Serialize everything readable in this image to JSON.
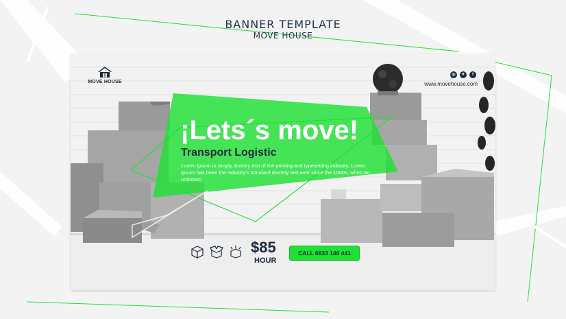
{
  "header": {
    "title": "BANNER TEMPLATE",
    "subtitle": "MOVE HOUSE"
  },
  "banner": {
    "logo_text": "MOVE HOUSE",
    "website": "www.movehouse.com",
    "social_icons": [
      "instagram-icon",
      "twitter-icon",
      "facebook-icon"
    ],
    "headline": "¡Lets´s move!",
    "subheadline": "Transport Logistic",
    "body": "Lorem Ipsum is simply dummy text of the printing and typesetting industry. Lorem Ipsum has been the industry's standard dummy text ever since the 1500s, when an unknown",
    "feature_icons": [
      "box-icon",
      "open-box-icon",
      "box-arrows-icon"
    ],
    "price": "$85",
    "price_unit": "HOUR",
    "cta_label": "CALL 6633 140 441"
  },
  "colors": {
    "accent_green": "#1fe035",
    "navy": "#1d2a3a",
    "page_bg": "#f3f3f3"
  }
}
